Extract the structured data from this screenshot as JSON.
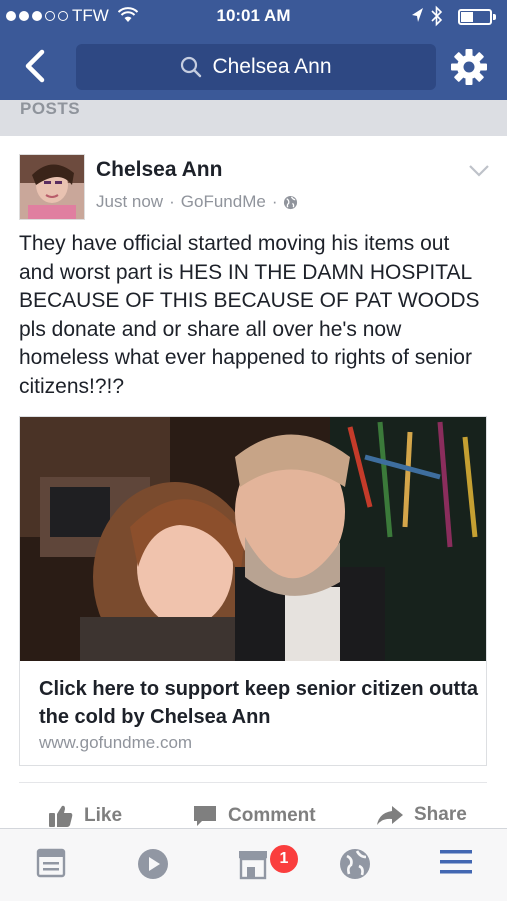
{
  "status_bar": {
    "carrier": "TFW",
    "time": "10:01 AM"
  },
  "header": {
    "search_text": "Chelsea Ann"
  },
  "section": {
    "label": "POSTS"
  },
  "post": {
    "author": "Chelsea Ann",
    "timestamp": "Just now",
    "source": "GoFundMe",
    "separator": "·",
    "text": "They have official started moving his items out and worst part is HES IN THE DAMN HOSPITAL BECAUSE OF THIS BECAUSE OF PAT WOODS pls donate and or share all over he's now homeless what ever happened to rights of senior citizens!?!?",
    "link": {
      "title": "Click here to support keep senior citizen outta the cold by Chelsea Ann",
      "url": "www.gofundme.com"
    },
    "actions": {
      "like": "Like",
      "comment": "Comment",
      "share": "Share"
    }
  },
  "tabbar": {
    "marketplace_badge": "1"
  },
  "colors": {
    "brand": "#3b5998",
    "badge": "#fa3e3e",
    "active_tab": "#4267b2"
  },
  "icons": [
    "back-icon",
    "search-icon",
    "settings-icon",
    "chevron-down-icon",
    "globe-icon",
    "like-icon",
    "comment-icon",
    "share-icon",
    "news-feed-icon",
    "video-icon",
    "marketplace-icon",
    "notifications-globe-icon",
    "menu-icon"
  ]
}
